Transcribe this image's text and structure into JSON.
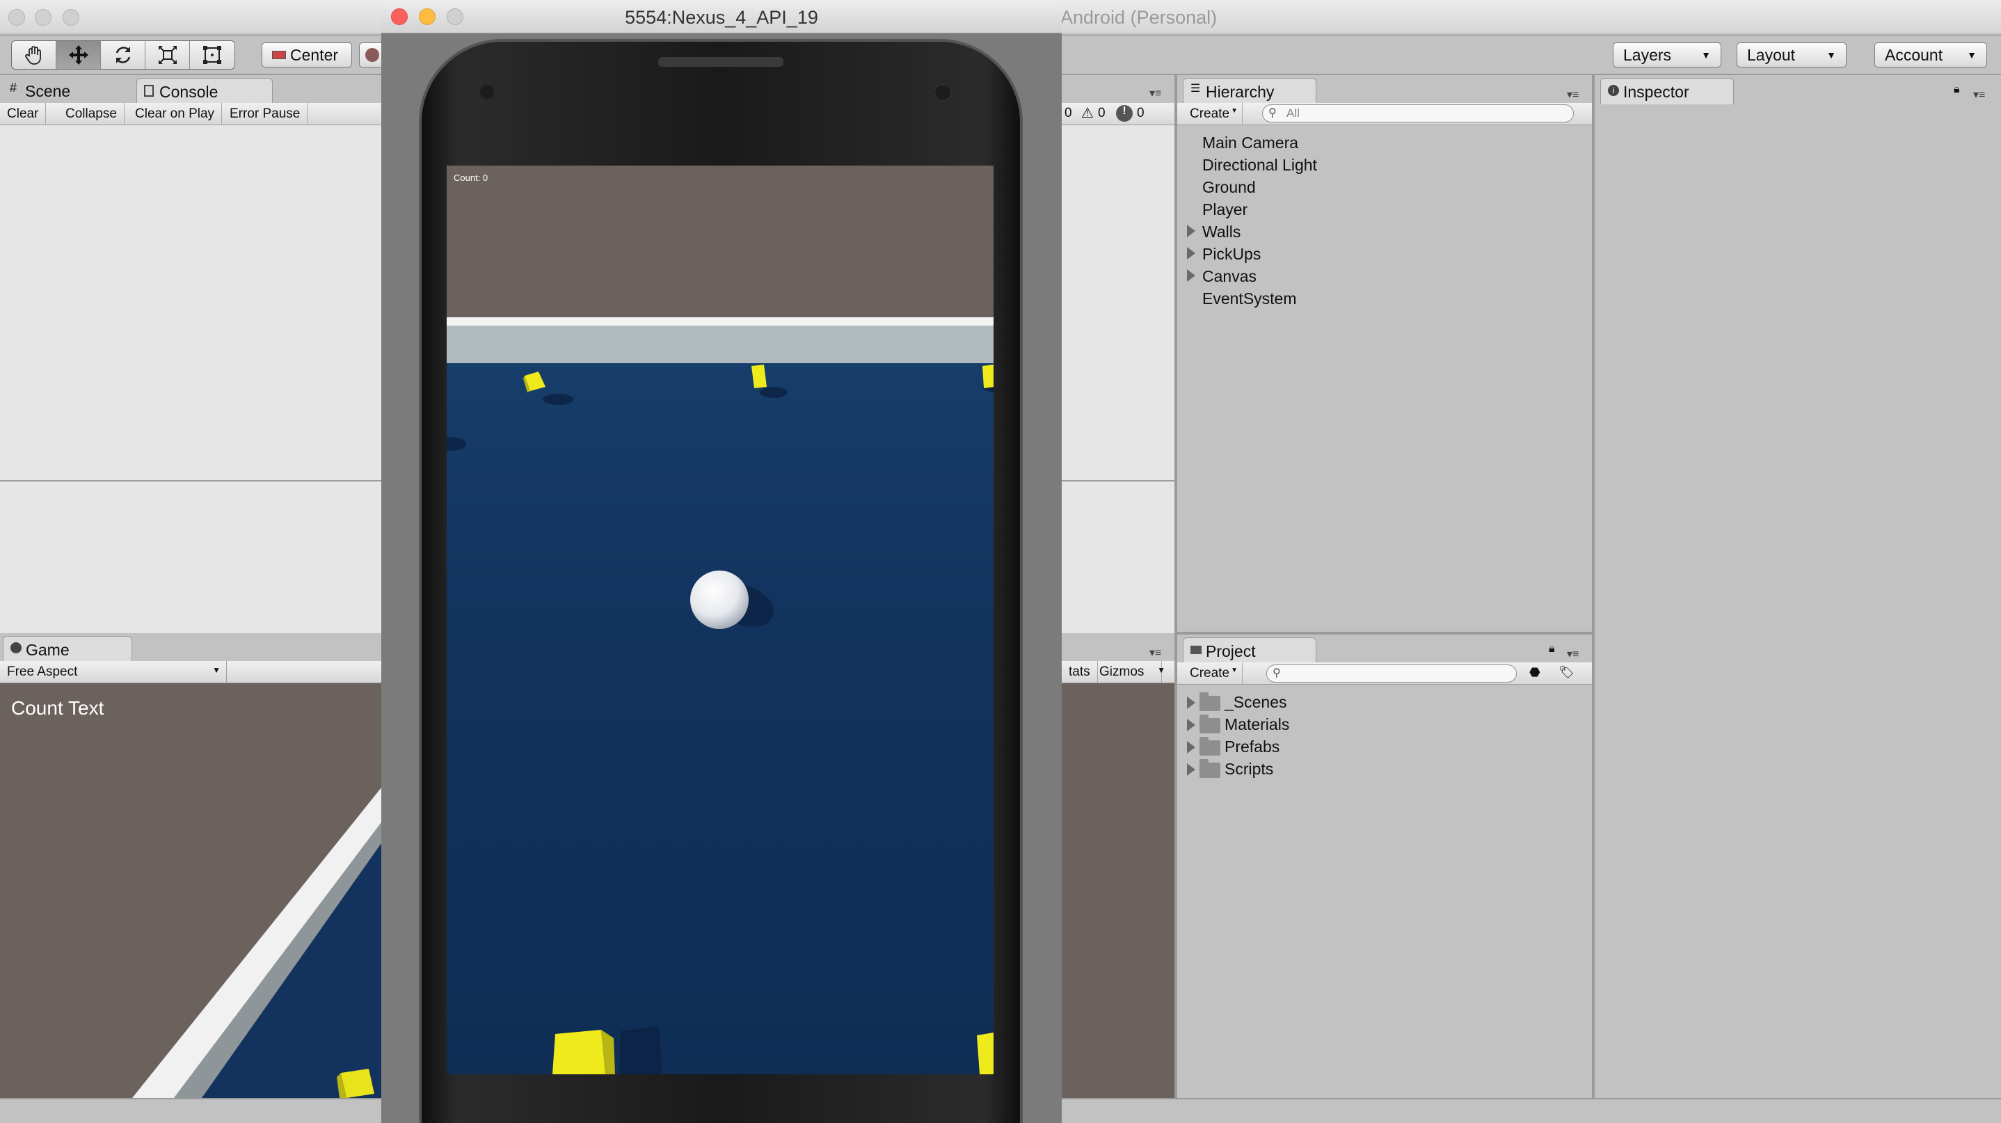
{
  "unity_window": {
    "title": "Android (Personal)"
  },
  "toolbar": {
    "tools": [
      "hand-tool",
      "move-tool",
      "rotate-tool",
      "scale-tool",
      "rect-tool"
    ],
    "pivot_label": "Center",
    "layers_label": "Layers",
    "layout_label": "Layout",
    "account_label": "Account"
  },
  "scene_console": {
    "scene_tab": "Scene",
    "console_tab": "Console",
    "buttons": [
      "Clear",
      "Collapse",
      "Clear on Play",
      "Error Pause"
    ],
    "info_count": "0",
    "warning_count": "0",
    "error_count": "0"
  },
  "game_panel": {
    "tab": "Game",
    "aspect": "Free Aspect",
    "stats_label": "tats",
    "gizmos_label": "Gizmos",
    "count_text": "Count Text"
  },
  "hierarchy": {
    "tab": "Hierarchy",
    "create_label": "Create",
    "search_placeholder": "All",
    "items": [
      {
        "label": "Main Camera",
        "expandable": false
      },
      {
        "label": "Directional Light",
        "expandable": false
      },
      {
        "label": "Ground",
        "expandable": false
      },
      {
        "label": "Player",
        "expandable": false
      },
      {
        "label": "Walls",
        "expandable": true
      },
      {
        "label": "PickUps",
        "expandable": true
      },
      {
        "label": "Canvas",
        "expandable": true
      },
      {
        "label": "EventSystem",
        "expandable": false
      }
    ]
  },
  "project": {
    "tab": "Project",
    "create_label": "Create",
    "folders": [
      "_Scenes",
      "Materials",
      "Prefabs",
      "Scripts"
    ]
  },
  "inspector": {
    "tab": "Inspector"
  },
  "emulator": {
    "title": "5554:Nexus_4_API_19",
    "count_label": "Count: 0"
  },
  "colors": {
    "unity_panel": "#c2c2c2",
    "game_sky": "#6b625d",
    "game_floor": "#12325d",
    "pickup_yellow": "#f0ec1c",
    "close_red": "#fc605c",
    "minimize_yellow": "#fdbc40"
  }
}
